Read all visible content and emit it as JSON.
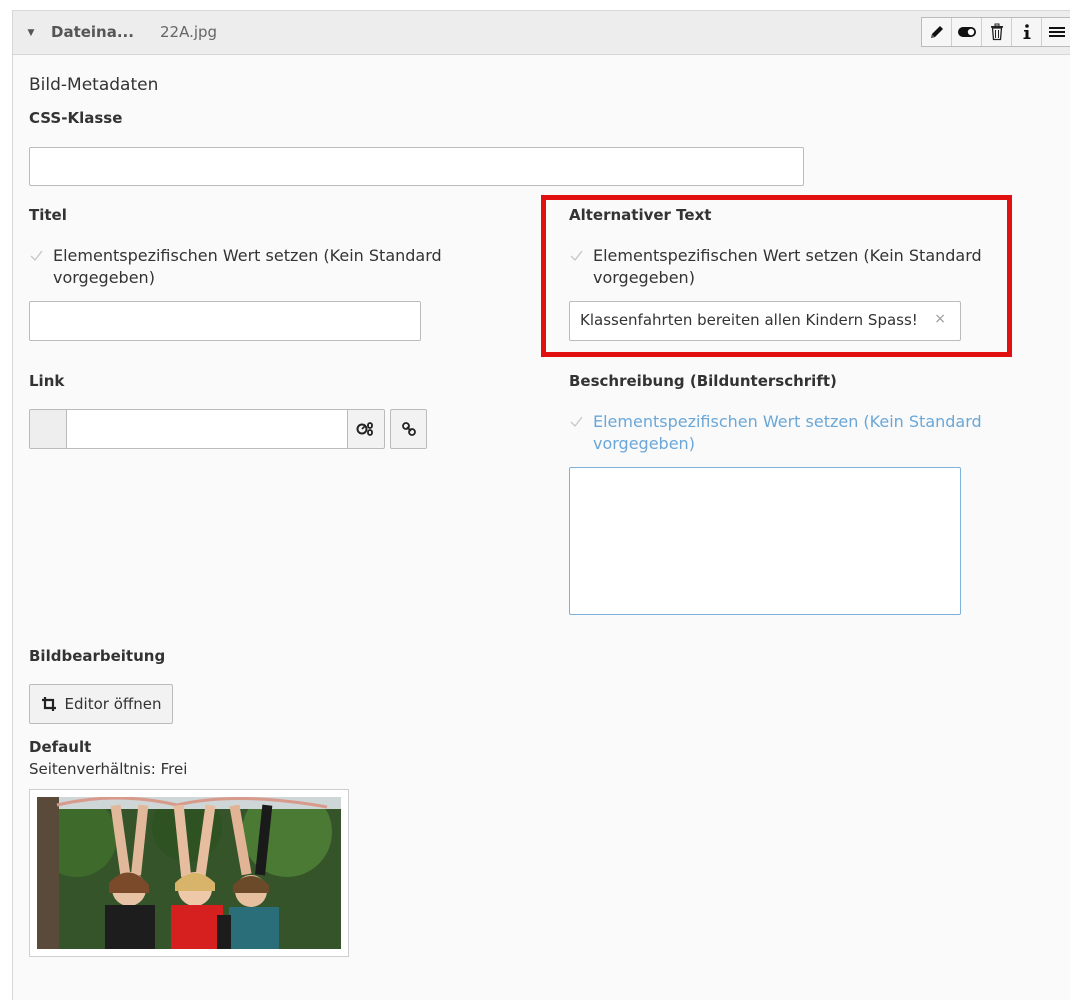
{
  "header": {
    "title": "Dateina...",
    "filename": "22A.jpg",
    "toolbar": [
      "pencil-icon",
      "toggle-icon",
      "trash-icon",
      "info-icon",
      "menu-icon"
    ]
  },
  "section_title": "Bild-Metadaten",
  "css_class": {
    "label": "CSS-Klasse",
    "value": ""
  },
  "titel": {
    "label": "Titel",
    "override_line1": "Elementspezifischen Wert setzen (Kein Standard",
    "override_line2": "vorgegeben)",
    "value": ""
  },
  "alt_text": {
    "label": "Alternativer Text",
    "override_line1": "Elementspezifischen Wert setzen (Kein Standard",
    "override_line2": "vorgegeben)",
    "value": "Klassenfahrten bereiten allen Kindern Spass!",
    "clear": "×"
  },
  "link": {
    "label": "Link",
    "value": ""
  },
  "beschreibung": {
    "label": "Beschreibung (Bildunterschrift)",
    "override_line1": "Elementspezifischen Wert setzen (Kein Standard",
    "override_line2": "vorgegeben)",
    "value": ""
  },
  "bildbearbeitung": {
    "label": "Bildbearbeitung",
    "editor_button": "Editor öffnen"
  },
  "crop": {
    "name": "Default",
    "ratio": "Seitenverhältnis: Frei"
  },
  "colors": {
    "highlight": "#e11111",
    "link_blue": "#6aa7d8"
  }
}
